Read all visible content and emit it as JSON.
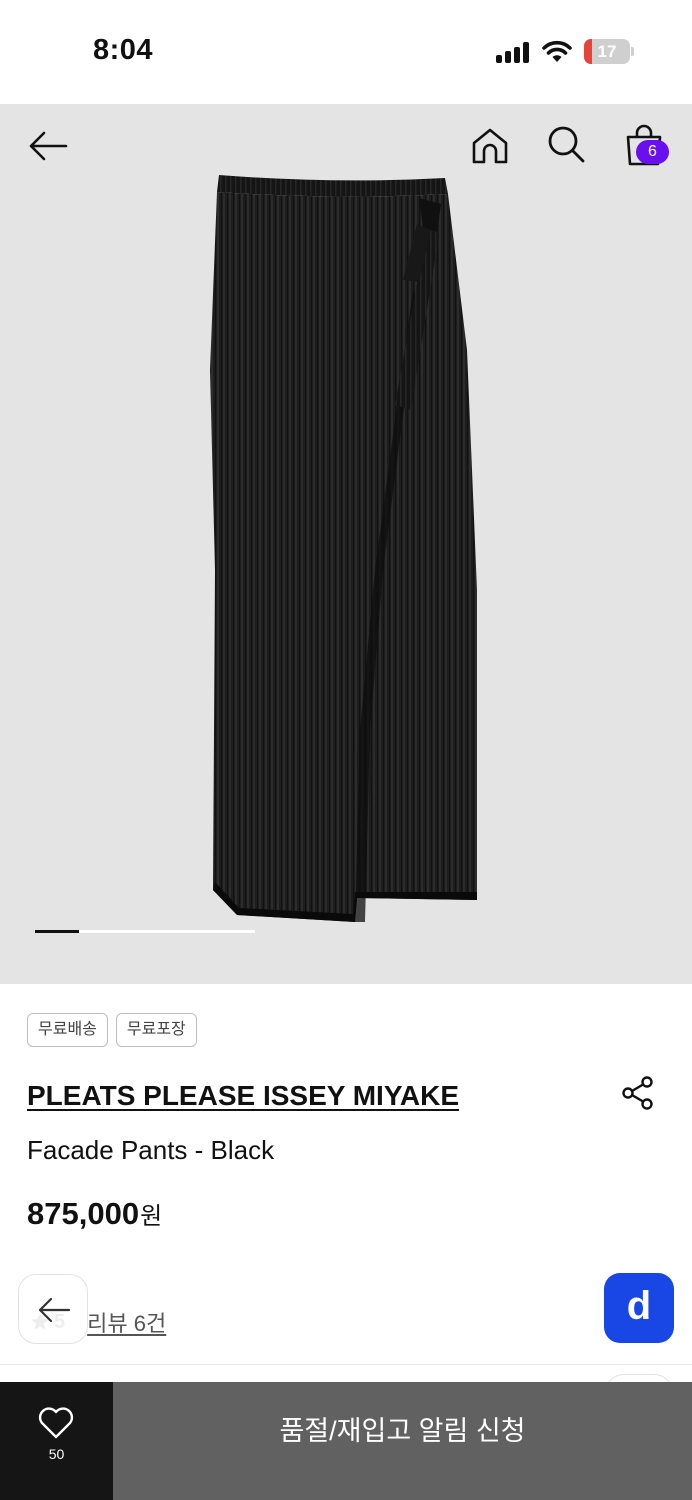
{
  "status_bar": {
    "time": "8:04",
    "battery": "17",
    "battery_level": 0.17,
    "icons": [
      "cellular-signal-icon",
      "wifi-icon",
      "battery-icon"
    ]
  },
  "header": {
    "icons": [
      "arrow-left-icon",
      "home-icon",
      "search-icon",
      "shopping-bag-icon"
    ],
    "cart_count": "6",
    "badge_color": "#6a10f0"
  },
  "gallery": {
    "background": "#e4e4e4",
    "current_progress": 0.2,
    "image_icon": "pleated-wrap-pants-image"
  },
  "product": {
    "tags": [
      "무료배송",
      "무료포장"
    ],
    "brand": "PLEATS PLEASE ISSEY MIYAKE",
    "name": "Facade Pants - Black",
    "price": "875,000",
    "currency": "원"
  },
  "reviews": {
    "rating": "5",
    "link_label": "리뷰 6건"
  },
  "floating": {
    "chat_letter": "d",
    "chat_color": "#1947e5"
  },
  "bottom_bar": {
    "wish_count": "50",
    "notify_label": "품절/재입고 알림 신청"
  }
}
